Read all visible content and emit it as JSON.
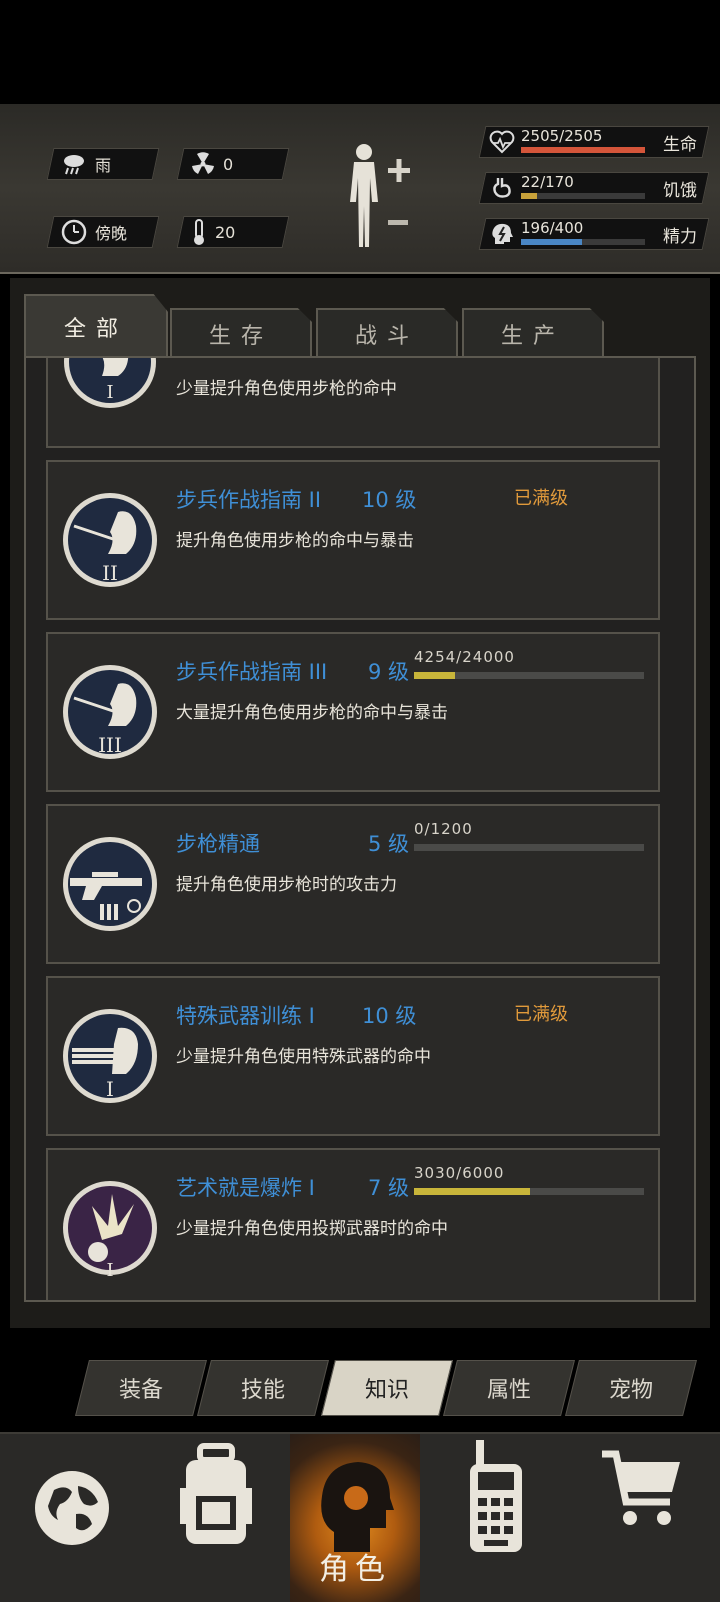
{
  "status": {
    "weather": "雨",
    "radiation": "0",
    "time_of_day": "傍晚",
    "temperature": "20",
    "health": {
      "text": "2505/2505",
      "label": "生命",
      "fraction": 1.0,
      "color": "#d4553a"
    },
    "hunger": {
      "text": "22/170",
      "label": "饥饿",
      "fraction": 0.13,
      "color": "#c8a23a"
    },
    "energy": {
      "text": "196/400",
      "label": "精力",
      "fraction": 0.49,
      "color": "#4a86c4"
    }
  },
  "tabs": [
    "全部",
    "生存",
    "战斗",
    "生产"
  ],
  "skills": [
    {
      "name": "",
      "level": "",
      "desc": "少量提升角色使用步枪的命中",
      "status": "",
      "xp": "",
      "xp_fraction": null,
      "icon": "rifle-marksman-icon",
      "numeral": "I"
    },
    {
      "name": "步兵作战指南 II",
      "level": "10 级",
      "desc": "提升角色使用步枪的命中与暴击",
      "status": "已满级",
      "xp": "",
      "xp_fraction": null,
      "icon": "rifle-marksman-icon",
      "numeral": "II"
    },
    {
      "name": "步兵作战指南 III",
      "level": "9 级",
      "desc": "大量提升角色使用步枪的命中与暴击",
      "status": "",
      "xp": "4254/24000",
      "xp_fraction": 0.177,
      "icon": "rifle-marksman-icon",
      "numeral": "III"
    },
    {
      "name": "步枪精通",
      "level": "5 级",
      "desc": "提升角色使用步枪时的攻击力",
      "status": "",
      "xp": "0/1200",
      "xp_fraction": 0,
      "icon": "rifle-ammo-icon",
      "numeral": ""
    },
    {
      "name": "特殊武器训练 I",
      "level": "10 级",
      "desc": "少量提升角色使用特殊武器的命中",
      "status": "已满级",
      "xp": "",
      "xp_fraction": null,
      "icon": "minigun-icon",
      "numeral": "I"
    },
    {
      "name": "艺术就是爆炸 I",
      "level": "7 级",
      "desc": "少量提升角色使用投掷武器时的命中",
      "status": "",
      "xp": "3030/6000",
      "xp_fraction": 0.505,
      "icon": "explosion-icon",
      "numeral": "I"
    }
  ],
  "sub_nav": [
    "装备",
    "技能",
    "知识",
    "属性",
    "宠物"
  ],
  "bottom_nav": {
    "active_label": "角色"
  }
}
